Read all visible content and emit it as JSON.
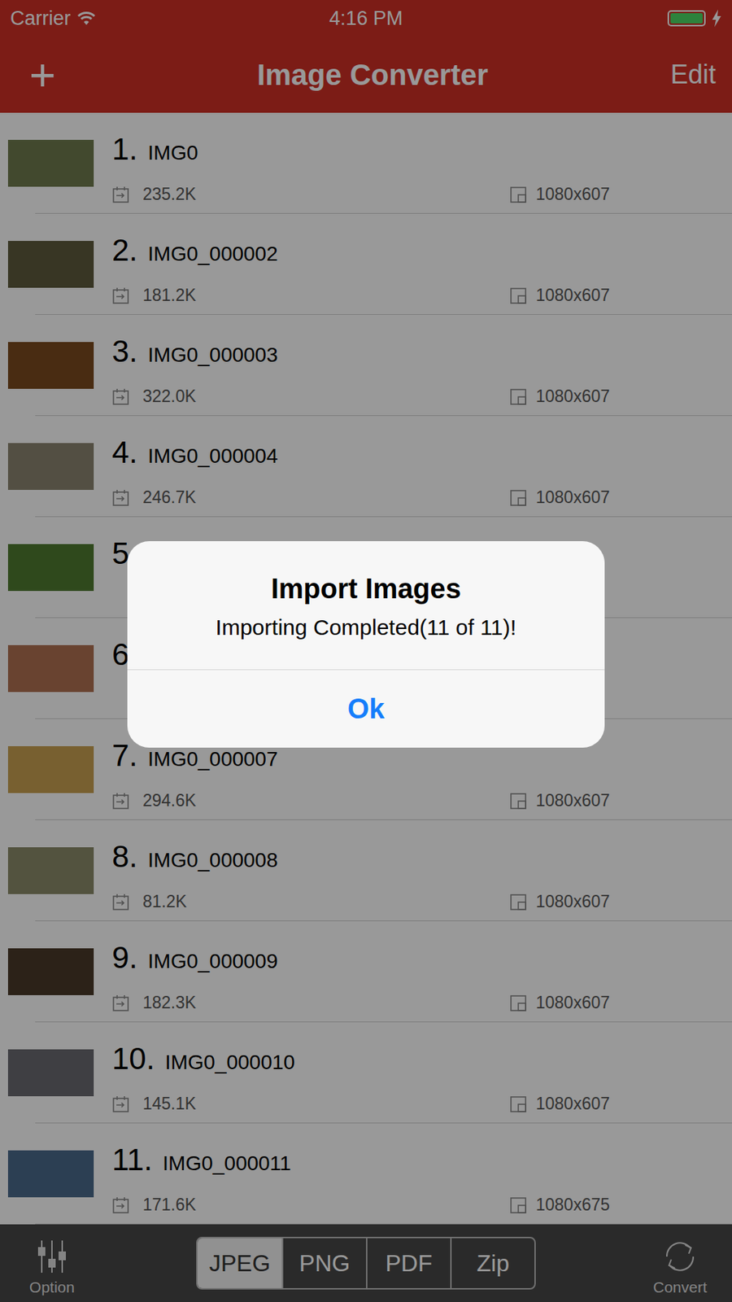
{
  "status_bar": {
    "carrier": "Carrier",
    "time": "4:16 PM"
  },
  "nav": {
    "add": "+",
    "title": "Image Converter",
    "edit": "Edit"
  },
  "rows": [
    {
      "number": "1.",
      "name": "IMG0",
      "size": "235.2K",
      "dimensions": "1080x607"
    },
    {
      "number": "2.",
      "name": "IMG0_000002",
      "size": "181.2K",
      "dimensions": "1080x607"
    },
    {
      "number": "3.",
      "name": "IMG0_000003",
      "size": "322.0K",
      "dimensions": "1080x607"
    },
    {
      "number": "4.",
      "name": "IMG0_000004",
      "size": "246.7K",
      "dimensions": "1080x607"
    },
    {
      "number": "5",
      "dimensions": "7"
    },
    {
      "number": "6",
      "dimensions": "7"
    },
    {
      "number": "7.",
      "name": "IMG0_000007",
      "size": "294.6K",
      "dimensions": "1080x607"
    },
    {
      "number": "8.",
      "name": "IMG0_000008",
      "size": "81.2K",
      "dimensions": "1080x607"
    },
    {
      "number": "9.",
      "name": "IMG0_000009",
      "size": "182.3K",
      "dimensions": "1080x607"
    },
    {
      "number": "10.",
      "name": "IMG0_000010",
      "size": "145.1K",
      "dimensions": "1080x607"
    },
    {
      "number": "11.",
      "name": "IMG0_000011",
      "size": "171.6K",
      "dimensions": "1080x675"
    }
  ],
  "toolbar": {
    "option": "Option",
    "convert": "Convert",
    "formats": [
      {
        "label": "JPEG",
        "selected": true
      },
      {
        "label": "PNG",
        "selected": false
      },
      {
        "label": "PDF",
        "selected": false
      },
      {
        "label": "Zip",
        "selected": false
      }
    ]
  },
  "alert": {
    "title": "Import Images",
    "message": "Importing Completed(11 of 11)!",
    "button": "Ok"
  }
}
